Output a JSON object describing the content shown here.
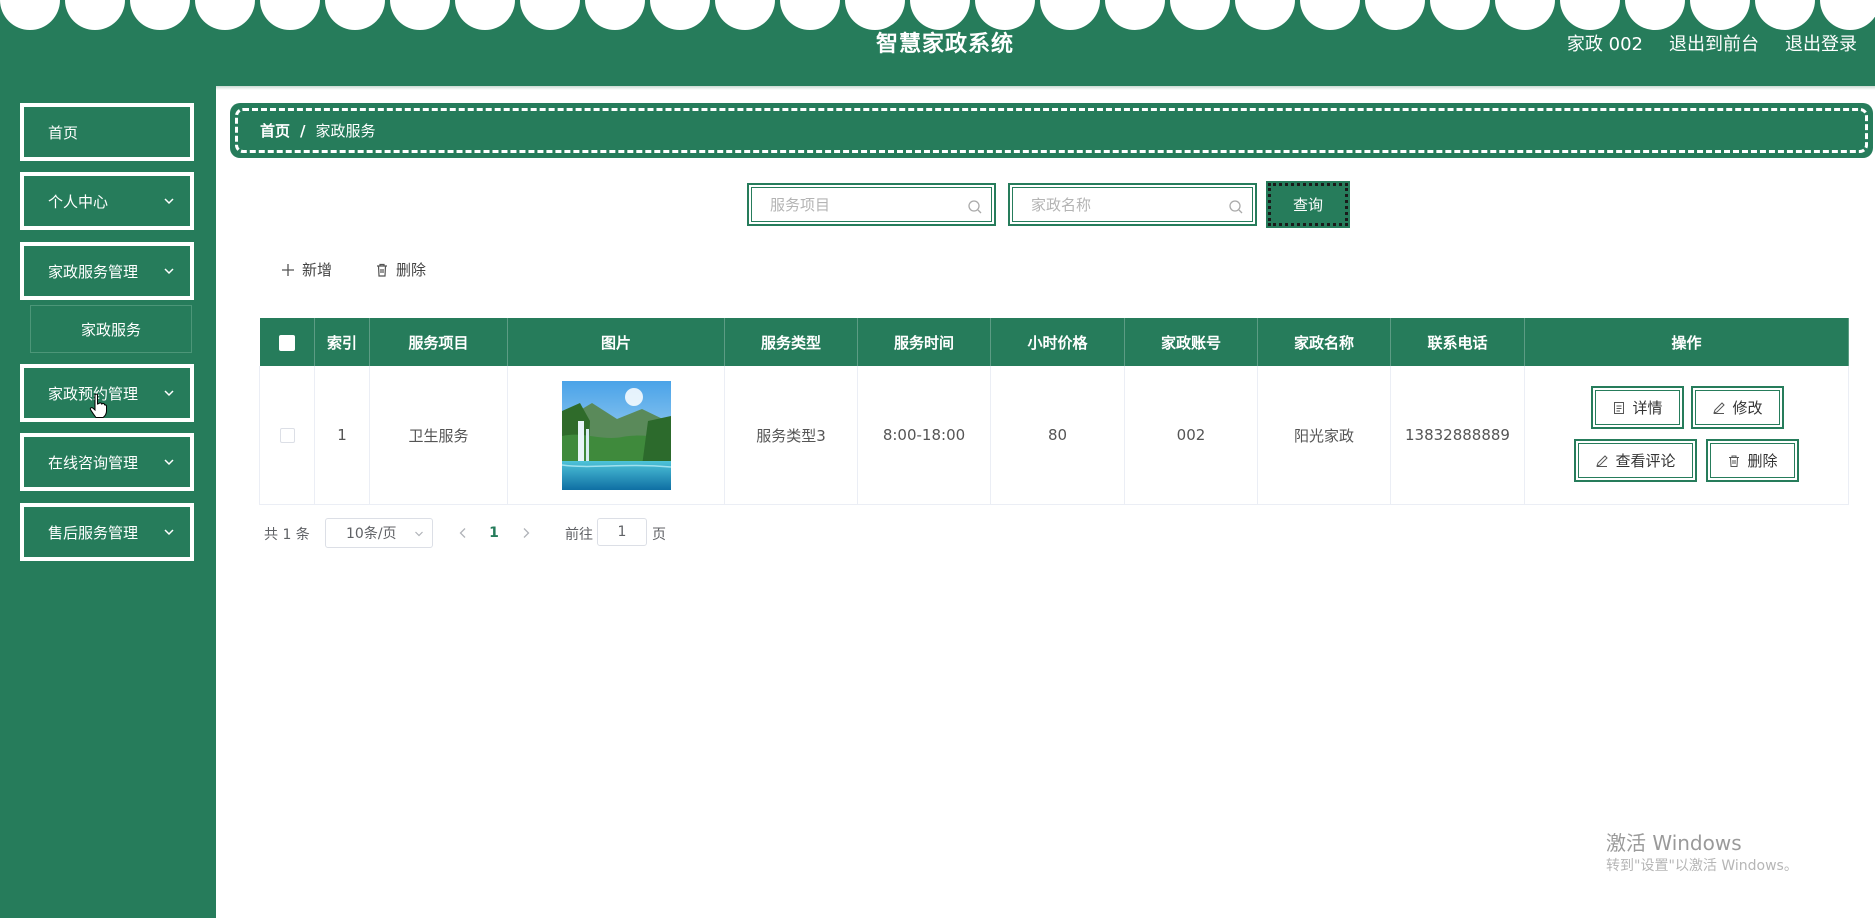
{
  "header": {
    "title": "智慧家政系统",
    "user": "家政 002",
    "to_front": "退出到前台",
    "logout": "退出登录"
  },
  "sidebar": {
    "items": [
      {
        "label": "首页"
      },
      {
        "label": "个人中心"
      },
      {
        "label": "家政服务管理"
      },
      {
        "label": "家政预约管理"
      },
      {
        "label": "在线咨询管理"
      },
      {
        "label": "售后服务管理"
      }
    ],
    "sub_item": "家政服务"
  },
  "breadcrumb": {
    "home": "首页",
    "sep": "/",
    "current": "家政服务"
  },
  "search": {
    "service_placeholder": "服务项目",
    "name_placeholder": "家政名称",
    "query_label": "查询"
  },
  "toolbar": {
    "add_label": "新增",
    "delete_label": "删除"
  },
  "table": {
    "columns": [
      "索引",
      "服务项目",
      "图片",
      "服务类型",
      "服务时间",
      "小时价格",
      "家政账号",
      "家政名称",
      "联系电话",
      "操作"
    ],
    "rows": [
      {
        "index": "1",
        "service": "卫生服务",
        "type": "服务类型3",
        "time": "8:00-18:00",
        "price": "80",
        "account": "002",
        "name": "阳光家政",
        "phone": "13832888889"
      }
    ],
    "actions": {
      "detail": "详情",
      "edit": "修改",
      "review": "查看评论",
      "delete": "删除"
    }
  },
  "pagination": {
    "total": "共 1 条",
    "page_size": "10条/页",
    "current_page": "1",
    "goto_label": "前往",
    "goto_value": "1",
    "goto_unit": "页"
  },
  "watermark": {
    "line1": "激活 Windows",
    "line2": "转到\"设置\"以激活 Windows。"
  },
  "colors": {
    "primary": "#267c5b",
    "white": "#ffffff"
  }
}
